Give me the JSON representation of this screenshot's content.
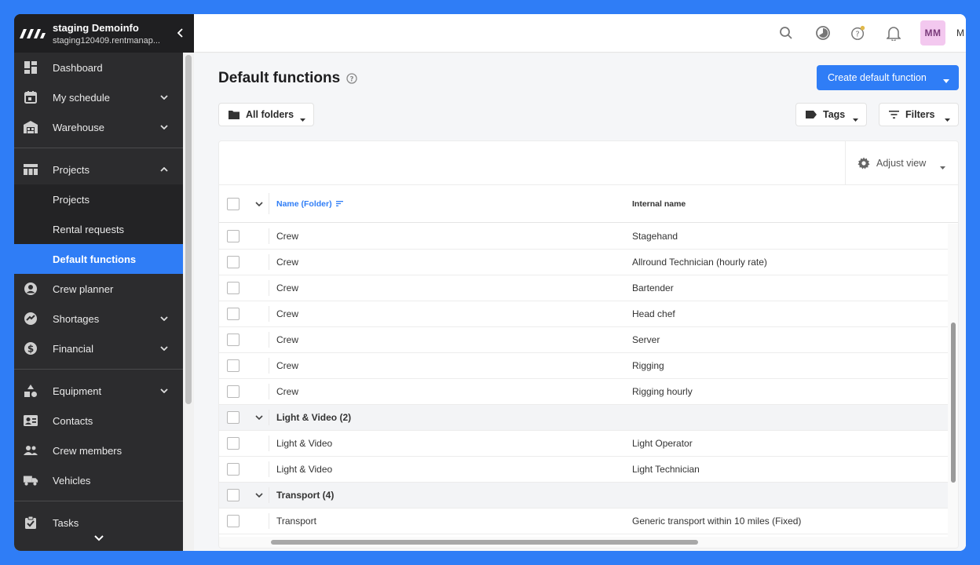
{
  "account": {
    "name": "staging Demoinfo",
    "url": "staging120409.rentmanap..."
  },
  "sidebar": {
    "items": [
      {
        "label": "Dashboard",
        "icon": "dashboard-icon"
      },
      {
        "label": "My schedule",
        "icon": "calendar-icon"
      },
      {
        "label": "Warehouse",
        "icon": "warehouse-icon"
      },
      {
        "label": "Projects",
        "icon": "projects-icon"
      },
      {
        "label": "Crew planner",
        "icon": "crew-planner-icon"
      },
      {
        "label": "Shortages",
        "icon": "shortages-icon"
      },
      {
        "label": "Financial",
        "icon": "dollar-icon"
      },
      {
        "label": "Equipment",
        "icon": "equipment-icon"
      },
      {
        "label": "Contacts",
        "icon": "contacts-icon"
      },
      {
        "label": "Crew members",
        "icon": "crew-members-icon"
      },
      {
        "label": "Vehicles",
        "icon": "truck-icon"
      },
      {
        "label": "Tasks",
        "icon": "tasks-icon"
      }
    ],
    "projects_sub": [
      "Projects",
      "Rental requests",
      "Default functions"
    ]
  },
  "topbar": {
    "avatar_initials": "MM",
    "avatar_extra": "M"
  },
  "page": {
    "title": "Default functions",
    "create_button": "Create default function",
    "folders_button": "All folders",
    "tags_button": "Tags",
    "filters_button": "Filters",
    "adjust_view": "Adjust view"
  },
  "table": {
    "col_name": "Name (Folder)",
    "col_internal": "Internal name",
    "rows": [
      {
        "name": "Crew",
        "internal": "Stagehand",
        "group": false
      },
      {
        "name": "Crew",
        "internal": "Allround Technician (hourly rate)",
        "group": false
      },
      {
        "name": "Crew",
        "internal": "Bartender",
        "group": false
      },
      {
        "name": "Crew",
        "internal": "Head chef",
        "group": false
      },
      {
        "name": "Crew",
        "internal": "Server",
        "group": false
      },
      {
        "name": "Crew",
        "internal": "Rigging",
        "group": false
      },
      {
        "name": "Crew",
        "internal": "Rigging hourly",
        "group": false
      },
      {
        "name": "Light & Video (2)",
        "internal": "",
        "group": true
      },
      {
        "name": "Light & Video",
        "internal": "Light Operator",
        "group": false
      },
      {
        "name": "Light & Video",
        "internal": "Light Technician",
        "group": false
      },
      {
        "name": "Transport (4)",
        "internal": "",
        "group": true
      },
      {
        "name": "Transport",
        "internal": "Generic transport within 10 miles (Fixed)",
        "group": false
      }
    ]
  },
  "colors": {
    "accent": "#2f7df6",
    "sidebar_bg": "#2c2c2e",
    "frame": "#2f7df6"
  }
}
